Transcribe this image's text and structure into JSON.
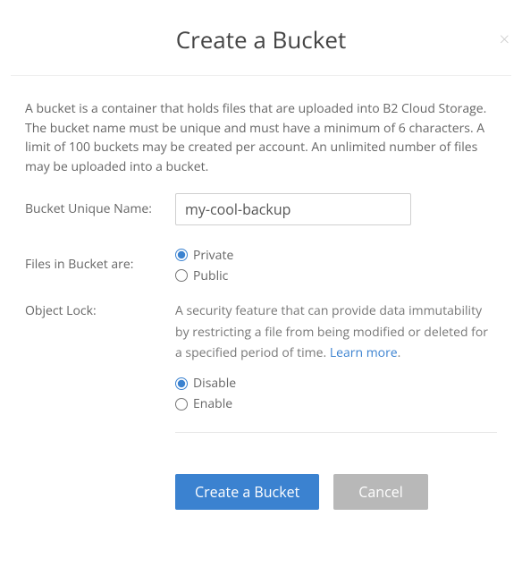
{
  "title": "Create a Bucket",
  "intro": "A bucket is a container that holds files that are uploaded into B2 Cloud Storage. The bucket name must be unique and must have a minimum of 6 characters. A limit of 100 buckets may be created per account. An unlimited number of files may be uploaded into a bucket.",
  "bucket_name": {
    "label": "Bucket Unique Name:",
    "value": "my-cool-backup"
  },
  "visibility": {
    "label": "Files in Bucket are:",
    "private": "Private",
    "public": "Public",
    "selected": "private"
  },
  "object_lock": {
    "label": "Object Lock:",
    "desc_prefix": "A security feature that can provide data immutability by restricting a file from being modified or deleted for a specified period of time. ",
    "learn_text": "Learn more",
    "desc_suffix": ".",
    "disable": "Disable",
    "enable": "Enable",
    "selected": "disable"
  },
  "buttons": {
    "create": "Create a Bucket",
    "cancel": "Cancel"
  }
}
